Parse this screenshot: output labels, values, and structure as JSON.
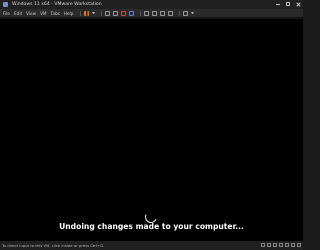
{
  "window": {
    "title": "Windows 11 x64 - VMware Workstation",
    "controls": [
      "minimize-icon",
      "maximize-icon",
      "close-icon"
    ]
  },
  "menu": {
    "items": [
      "File",
      "Edit",
      "View",
      "VM",
      "Tabs",
      "Help"
    ]
  },
  "toolbar": {
    "icons": [
      "pause-icon",
      "dropdown-icon",
      "send-ctrl-alt-del-icon",
      "snapshot-icon",
      "revert-snapshot-icon",
      "snapshot-manager-icon",
      "library-icon",
      "thumbnail-icon",
      "fullscreen-icon",
      "unity-icon",
      "console-view-icon",
      "stretch-icon"
    ]
  },
  "screen": {
    "message": "Undoing changes made to your computer...",
    "background": "#000000"
  },
  "statusbar": {
    "hint": "To direct input to this VM, click inside or press Ctrl+G.",
    "icons": [
      "hdd-icon",
      "cd-icon",
      "network-icon",
      "usb-icon",
      "sound-icon",
      "printer-icon",
      "display-icon"
    ]
  },
  "colors": {
    "accent_pause": "#e07020",
    "frame": "#202020"
  }
}
